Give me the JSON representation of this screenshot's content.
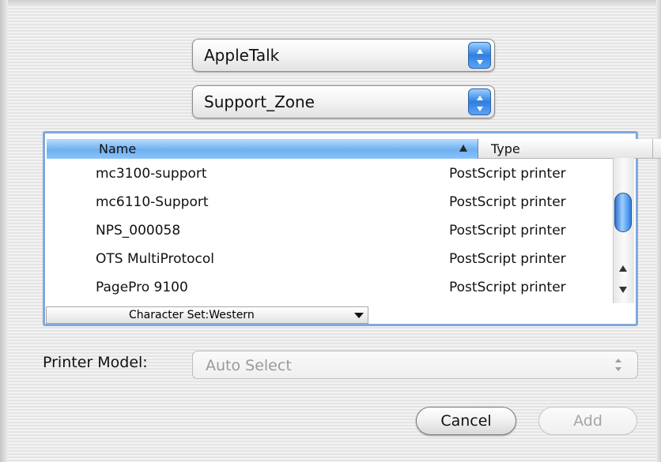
{
  "connection": {
    "selected": "AppleTalk"
  },
  "zone": {
    "selected": "Support_Zone"
  },
  "printer_list": {
    "columns": {
      "name": "Name",
      "type": "Type"
    },
    "rows": [
      {
        "name": "mc3100-support",
        "type": "PostScript printer"
      },
      {
        "name": "mc6110-Support",
        "type": "PostScript printer"
      },
      {
        "name": "NPS_000058",
        "type": "PostScript printer"
      },
      {
        "name": "OTS MultiProtocol",
        "type": "PostScript printer"
      },
      {
        "name": "PagePro 9100",
        "type": "PostScript printer"
      }
    ],
    "character_set": "Character Set:Western"
  },
  "printer_model": {
    "label": "Printer Model:",
    "value": "Auto Select"
  },
  "buttons": {
    "cancel": "Cancel",
    "add": "Add"
  },
  "colors": {
    "accent": "#3a85e6",
    "header_selected": "#8ac3fb",
    "disabled_text": "#9a9a9a"
  }
}
